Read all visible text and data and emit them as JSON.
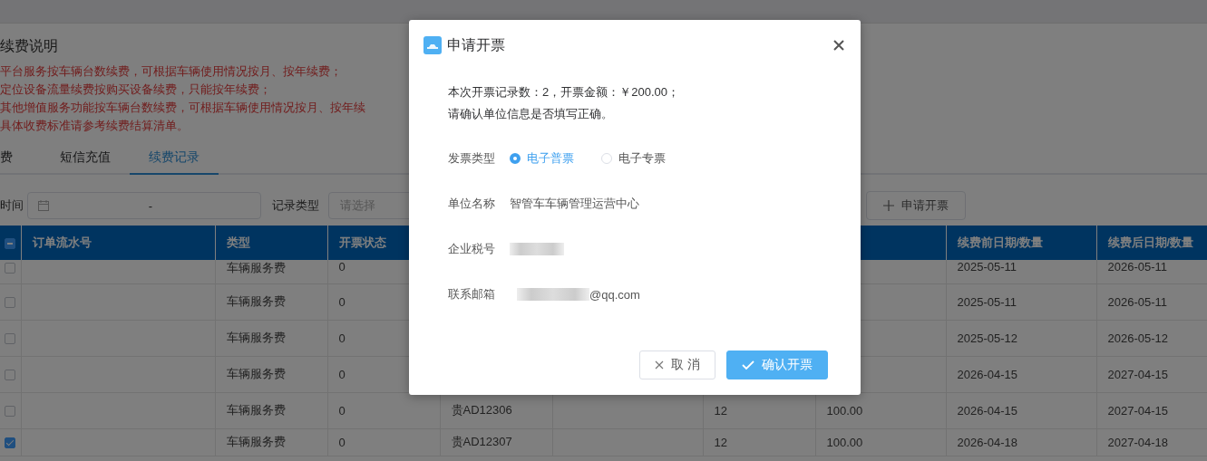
{
  "page": {
    "title": "续费说明",
    "notes": [
      "平台服务按车辆台数续费，可根据车辆使用情况按月、按年续费；",
      "定位设备流量续费按购买设备续费，只能按年续费；",
      "其他增值服务功能按车辆台数续费，可根据车辆使用情况按月、按年续",
      "具体收费标准请参考续费结算清单。"
    ],
    "tabs": [
      {
        "label": "费",
        "selected": false
      },
      {
        "label": "短信充值",
        "selected": false
      },
      {
        "label": "续费记录",
        "selected": true
      }
    ],
    "filters": {
      "time_label": "时间",
      "date_separator": "-",
      "type_label": "记录类型",
      "type_placeholder": "请选择",
      "apply_button": "申请开票"
    },
    "table": {
      "select_all_indeterminate": true,
      "columns": [
        "订单流水号",
        "类型",
        "开票状态",
        null,
        null,
        null,
        null,
        "续费前日期/数量",
        "续费后日期/数量"
      ],
      "rows": [
        {
          "selected": false,
          "cells": [
            null,
            "车辆服务费",
            "0",
            null,
            null,
            null,
            null,
            "2025-05-11",
            "2026-05-11"
          ]
        },
        {
          "selected": false,
          "cells": [
            null,
            "车辆服务费",
            "0",
            null,
            null,
            null,
            null,
            "2025-05-11",
            "2026-05-11"
          ]
        },
        {
          "selected": false,
          "cells": [
            null,
            "车辆服务费",
            "0",
            null,
            null,
            null,
            null,
            "2025-05-12",
            "2026-05-12"
          ]
        },
        {
          "selected": false,
          "cells": [
            null,
            "车辆服务费",
            "0",
            null,
            null,
            null,
            null,
            "2026-04-15",
            "2027-04-15"
          ]
        },
        {
          "selected": false,
          "cells": [
            null,
            "车辆服务费",
            "0",
            "贵AD12306",
            null,
            "12",
            "100.00",
            "2026-04-15",
            "2027-04-15"
          ]
        },
        {
          "selected": true,
          "cells": [
            null,
            "车辆服务费",
            "0",
            "贵AD12307",
            null,
            "12",
            "100.00",
            "2026-04-18",
            "2027-04-18"
          ]
        }
      ]
    }
  },
  "dialog": {
    "title": "申请开票",
    "summary": [
      "本次开票记录数：2，开票金额：￥200.00；",
      "请确认单位信息是否填写正确。"
    ],
    "fields": [
      {
        "kind": "radio",
        "label": "发票类型",
        "options": [
          {
            "label": "电子普票",
            "selected": true
          },
          {
            "label": "电子专票",
            "selected": false
          }
        ]
      },
      {
        "kind": "text",
        "label": "单位名称",
        "value": "智管车车辆管理运营中心"
      },
      {
        "kind": "redacted",
        "label": "企业税号"
      },
      {
        "kind": "redacted",
        "label": "联系邮箱",
        "value": "@qq.com"
      }
    ],
    "buttons": [
      {
        "kind": "cancel",
        "label": "取 消"
      },
      {
        "kind": "primary",
        "label": "确认开票"
      }
    ]
  }
}
